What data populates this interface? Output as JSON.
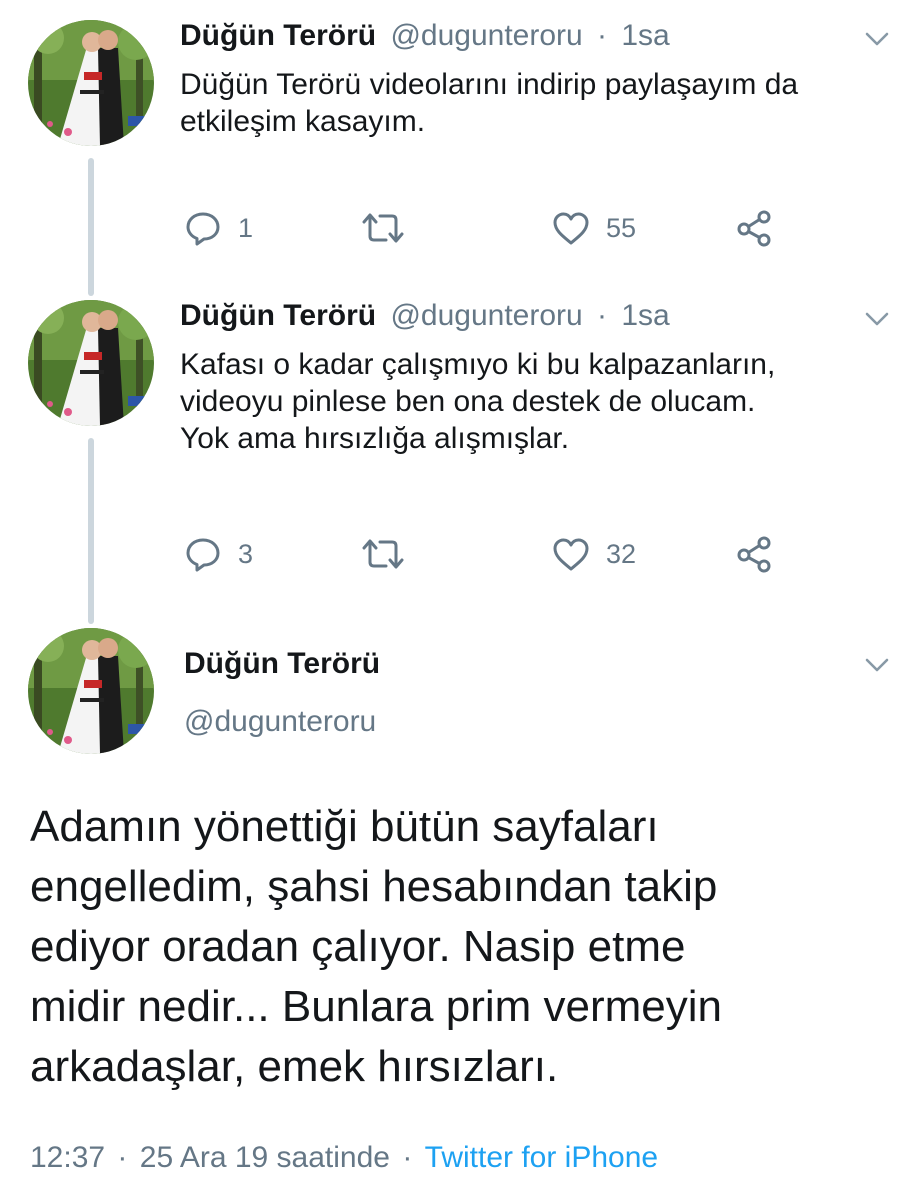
{
  "colors": {
    "text": "#14171a",
    "muted": "#657786",
    "link": "#1da1f2",
    "thread_line": "#ccd6dd"
  },
  "avatar": {
    "description_icon": "wedding-couple-avatar"
  },
  "thread": [
    {
      "name": "Düğün Terörü",
      "handle": "@duguntero ru",
      "handle_text": "@dugunteroru",
      "separator": "·",
      "time": "1sa",
      "lines": [
        "Düğün Terörü videolarını indirip paylaşayım da",
        "etkileşim kasayım."
      ],
      "replies": "1",
      "likes": "55"
    },
    {
      "name": "Düğün Terörü",
      "handle_text": "@dugunteroru",
      "separator": "·",
      "time": "1sa",
      "lines": [
        "Kafası o kadar çalışmıyo ki bu kalpazanların,",
        "videoyu pinlese ben ona destek de olucam.",
        "Yok ama hırsızlığa alışmışlar."
      ],
      "replies": "3",
      "likes": "32"
    }
  ],
  "main_tweet": {
    "name": "Düğün Terörü",
    "handle": "@dugunteroru",
    "lines": [
      "Adamın yönettiği bütün sayfaları",
      "engelledim, şahsi hesabından takip",
      "ediyor oradan çalıyor. Nasip etme",
      "midir nedir... Bunlara prim vermeyin",
      "arkadaşlar, emek hırsızları."
    ],
    "time": "12:37",
    "separator": "·",
    "date": "25 Ara 19 saatinde",
    "source": "Twitter for iPhone"
  },
  "icons": {
    "reply": "reply-icon",
    "retweet": "retweet-icon",
    "like": "heart-icon",
    "share": "share-icon",
    "menu": "chevron-down-icon"
  }
}
